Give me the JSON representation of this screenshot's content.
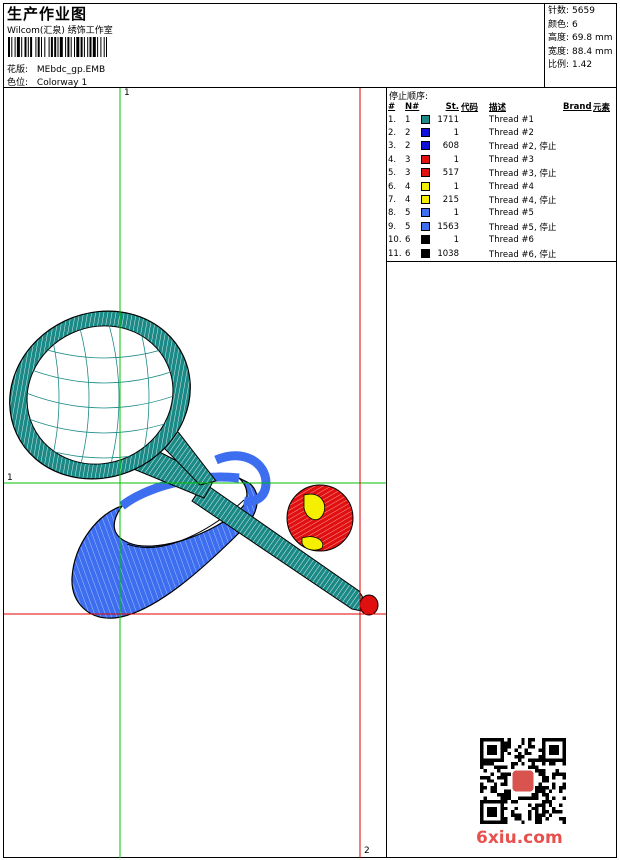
{
  "header": {
    "title": "生产作业图",
    "subtitle": "Wilcom(汇泉) 绣饰工作室",
    "design_label": "花版:",
    "design_value": "MEbdc_gp.EMB",
    "colorway_label": "色位:",
    "colorway_value": "Colorway 1"
  },
  "stats": [
    {
      "label": "针数:",
      "value": "5659"
    },
    {
      "label": "颜色:",
      "value": "6"
    },
    {
      "label": "高度:",
      "value": "69.8 mm"
    },
    {
      "label": "宽度:",
      "value": "88.4 mm"
    },
    {
      "label": "比例:",
      "value": "1.42"
    }
  ],
  "stop_sequence": {
    "title": "停止顺序:",
    "headers": [
      "#",
      "N#",
      "St.",
      "代码",
      "描述",
      "Brand",
      "元素"
    ],
    "rows": [
      {
        "idx": "1.",
        "n": "1",
        "color": "#1b8a86",
        "stitches": "1711",
        "desc": "Thread #1"
      },
      {
        "idx": "2.",
        "n": "2",
        "color": "#1010d8",
        "stitches": "1",
        "desc": "Thread #2"
      },
      {
        "idx": "3.",
        "n": "2",
        "color": "#1010d8",
        "stitches": "608",
        "desc": "Thread #2, 停止"
      },
      {
        "idx": "4.",
        "n": "3",
        "color": "#e01010",
        "stitches": "1",
        "desc": "Thread #3"
      },
      {
        "idx": "5.",
        "n": "3",
        "color": "#e01010",
        "stitches": "517",
        "desc": "Thread #3, 停止"
      },
      {
        "idx": "6.",
        "n": "4",
        "color": "#f4f000",
        "stitches": "1",
        "desc": "Thread #4"
      },
      {
        "idx": "7.",
        "n": "4",
        "color": "#f4f000",
        "stitches": "215",
        "desc": "Thread #4, 停止"
      },
      {
        "idx": "8.",
        "n": "5",
        "color": "#3d6ef0",
        "stitches": "1",
        "desc": "Thread #5"
      },
      {
        "idx": "9.",
        "n": "5",
        "color": "#3d6ef0",
        "stitches": "1563",
        "desc": "Thread #5, 停止"
      },
      {
        "idx": "10.",
        "n": "6",
        "color": "#000000",
        "stitches": "1",
        "desc": "Thread #6"
      },
      {
        "idx": "11.",
        "n": "6",
        "color": "#000000",
        "stitches": "1038",
        "desc": "Thread #6, 停止"
      }
    ]
  },
  "markers": {
    "v1": "1",
    "h1": "1",
    "v2": "2",
    "h2": "2"
  },
  "watermark": "6xiu.com"
}
